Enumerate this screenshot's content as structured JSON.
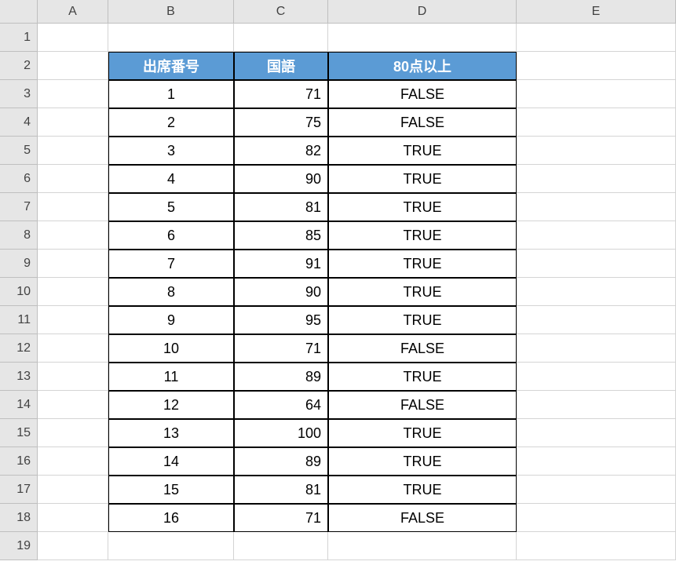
{
  "columns": [
    "A",
    "B",
    "C",
    "D",
    "E"
  ],
  "rowCount": 19,
  "headers": {
    "b": "出席番号",
    "c": "国語",
    "d": "80点以上"
  },
  "rows": [
    {
      "id": "1",
      "score": "71",
      "result": "FALSE"
    },
    {
      "id": "2",
      "score": "75",
      "result": "FALSE"
    },
    {
      "id": "3",
      "score": "82",
      "result": "TRUE"
    },
    {
      "id": "4",
      "score": "90",
      "result": "TRUE"
    },
    {
      "id": "5",
      "score": "81",
      "result": "TRUE"
    },
    {
      "id": "6",
      "score": "85",
      "result": "TRUE"
    },
    {
      "id": "7",
      "score": "91",
      "result": "TRUE"
    },
    {
      "id": "8",
      "score": "90",
      "result": "TRUE"
    },
    {
      "id": "9",
      "score": "95",
      "result": "TRUE"
    },
    {
      "id": "10",
      "score": "71",
      "result": "FALSE"
    },
    {
      "id": "11",
      "score": "89",
      "result": "TRUE"
    },
    {
      "id": "12",
      "score": "64",
      "result": "FALSE"
    },
    {
      "id": "13",
      "score": "100",
      "result": "TRUE"
    },
    {
      "id": "14",
      "score": "89",
      "result": "TRUE"
    },
    {
      "id": "15",
      "score": "81",
      "result": "TRUE"
    },
    {
      "id": "16",
      "score": "71",
      "result": "FALSE"
    }
  ]
}
